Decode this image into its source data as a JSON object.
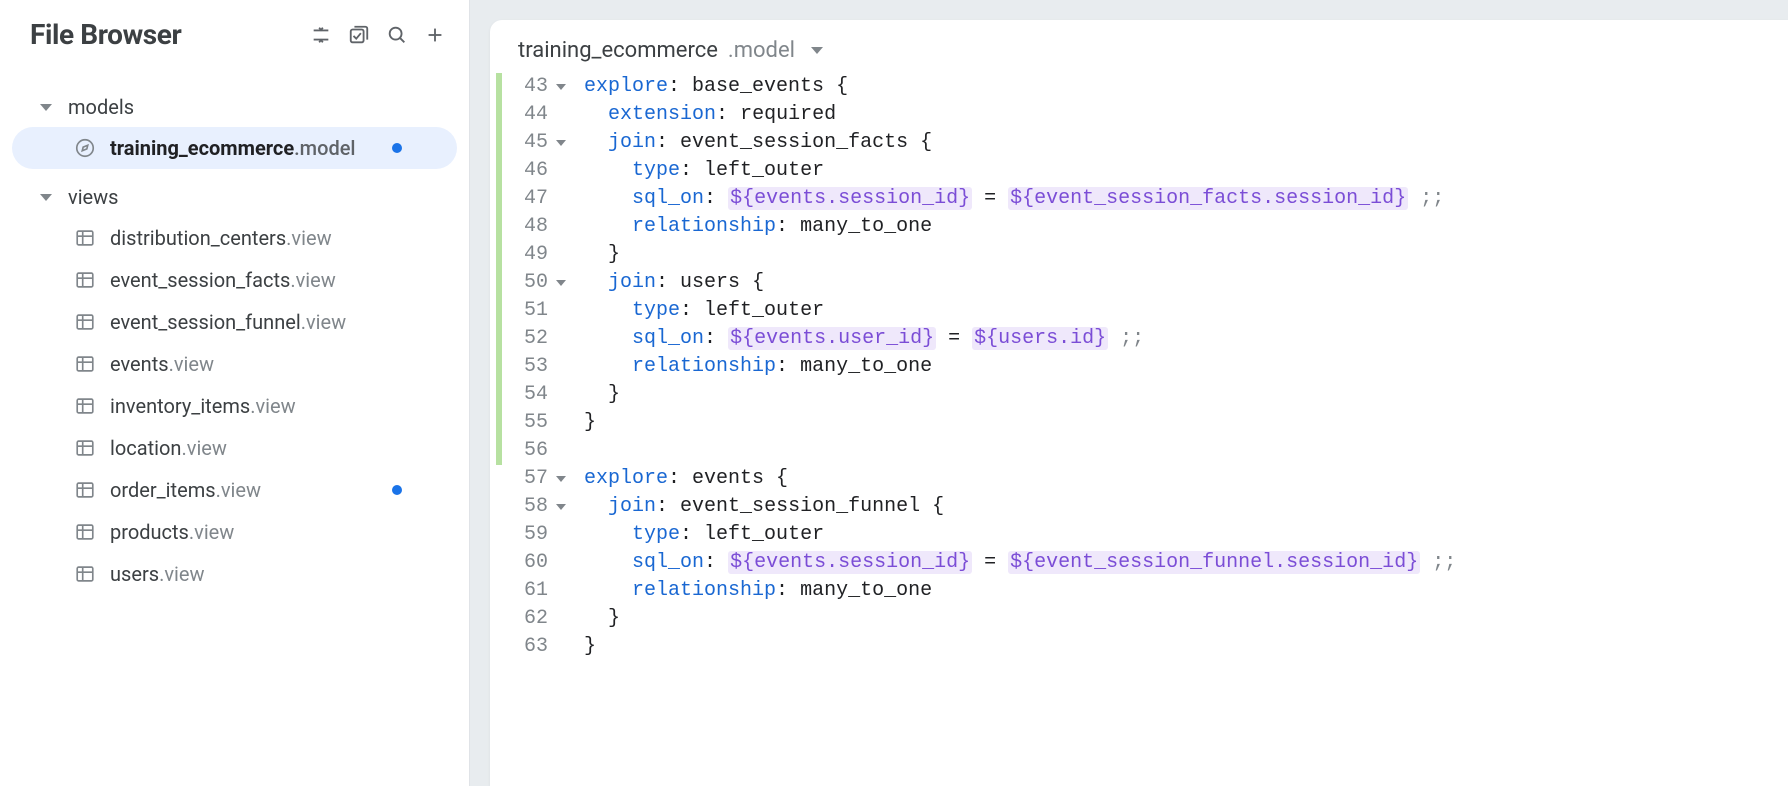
{
  "sidebar": {
    "title": "File Browser",
    "folders": [
      {
        "label": "models",
        "files": [
          {
            "name": "training_ecommerce",
            "ext": ".model",
            "icon": "compass",
            "active": true,
            "modified": true
          }
        ]
      },
      {
        "label": "views",
        "files": [
          {
            "name": "distribution_centers",
            "ext": ".view",
            "icon": "table",
            "active": false,
            "modified": false
          },
          {
            "name": "event_session_facts",
            "ext": ".view",
            "icon": "table",
            "active": false,
            "modified": false
          },
          {
            "name": "event_session_funnel",
            "ext": ".view",
            "icon": "table",
            "active": false,
            "modified": false
          },
          {
            "name": "events",
            "ext": ".view",
            "icon": "table",
            "active": false,
            "modified": false
          },
          {
            "name": "inventory_items",
            "ext": ".view",
            "icon": "table",
            "active": false,
            "modified": false
          },
          {
            "name": "location",
            "ext": ".view",
            "icon": "table",
            "active": false,
            "modified": false
          },
          {
            "name": "order_items",
            "ext": ".view",
            "icon": "table",
            "active": false,
            "modified": true
          },
          {
            "name": "products",
            "ext": ".view",
            "icon": "table",
            "active": false,
            "modified": false
          },
          {
            "name": "users",
            "ext": ".view",
            "icon": "table",
            "active": false,
            "modified": false
          }
        ]
      }
    ]
  },
  "editor": {
    "tab": {
      "name": "training_ecommerce",
      "ext": ".model"
    },
    "first_line_number": 43,
    "lines": [
      {
        "n": 43,
        "mod": true,
        "fold": true,
        "indent": 0,
        "tokens": [
          [
            "key",
            "explore"
          ],
          [
            "punc",
            ":"
          ],
          [
            "plain",
            " base_events "
          ],
          [
            "punc",
            "{"
          ]
        ]
      },
      {
        "n": 44,
        "mod": true,
        "fold": false,
        "indent": 1,
        "tokens": [
          [
            "key",
            "extension"
          ],
          [
            "punc",
            ":"
          ],
          [
            "plain",
            " required"
          ]
        ]
      },
      {
        "n": 45,
        "mod": true,
        "fold": true,
        "indent": 1,
        "tokens": [
          [
            "key",
            "join"
          ],
          [
            "punc",
            ":"
          ],
          [
            "plain",
            " event_session_facts "
          ],
          [
            "punc",
            "{"
          ]
        ]
      },
      {
        "n": 46,
        "mod": true,
        "fold": false,
        "indent": 2,
        "tokens": [
          [
            "key",
            "type"
          ],
          [
            "punc",
            ":"
          ],
          [
            "plain",
            " left_outer"
          ]
        ]
      },
      {
        "n": 47,
        "mod": true,
        "fold": false,
        "indent": 2,
        "tokens": [
          [
            "key",
            "sql_on"
          ],
          [
            "punc",
            ":"
          ],
          [
            "plain",
            " "
          ],
          [
            "int",
            "${events.session_id}"
          ],
          [
            "plain",
            " = "
          ],
          [
            "int",
            "${event_session_facts.session_id}"
          ],
          [
            "plain",
            " "
          ],
          [
            "semi",
            ";;"
          ]
        ]
      },
      {
        "n": 48,
        "mod": true,
        "fold": false,
        "indent": 2,
        "tokens": [
          [
            "key",
            "relationship"
          ],
          [
            "punc",
            ":"
          ],
          [
            "plain",
            " many_to_one"
          ]
        ]
      },
      {
        "n": 49,
        "mod": true,
        "fold": false,
        "indent": 1,
        "tokens": [
          [
            "punc",
            "}"
          ]
        ]
      },
      {
        "n": 50,
        "mod": true,
        "fold": true,
        "indent": 1,
        "tokens": [
          [
            "key",
            "join"
          ],
          [
            "punc",
            ":"
          ],
          [
            "plain",
            " users "
          ],
          [
            "punc",
            "{"
          ]
        ]
      },
      {
        "n": 51,
        "mod": true,
        "fold": false,
        "indent": 2,
        "tokens": [
          [
            "key",
            "type"
          ],
          [
            "punc",
            ":"
          ],
          [
            "plain",
            " left_outer"
          ]
        ]
      },
      {
        "n": 52,
        "mod": true,
        "fold": false,
        "indent": 2,
        "tokens": [
          [
            "key",
            "sql_on"
          ],
          [
            "punc",
            ":"
          ],
          [
            "plain",
            " "
          ],
          [
            "int",
            "${events.user_id}"
          ],
          [
            "plain",
            " = "
          ],
          [
            "int",
            "${users.id}"
          ],
          [
            "plain",
            " "
          ],
          [
            "semi",
            ";;"
          ]
        ]
      },
      {
        "n": 53,
        "mod": true,
        "fold": false,
        "indent": 2,
        "tokens": [
          [
            "key",
            "relationship"
          ],
          [
            "punc",
            ":"
          ],
          [
            "plain",
            " many_to_one"
          ]
        ]
      },
      {
        "n": 54,
        "mod": true,
        "fold": false,
        "indent": 1,
        "tokens": [
          [
            "punc",
            "}"
          ]
        ]
      },
      {
        "n": 55,
        "mod": true,
        "fold": false,
        "indent": 0,
        "tokens": [
          [
            "punc",
            "}"
          ]
        ]
      },
      {
        "n": 56,
        "mod": true,
        "fold": false,
        "indent": 0,
        "tokens": []
      },
      {
        "n": 57,
        "mod": false,
        "fold": true,
        "indent": 0,
        "tokens": [
          [
            "key",
            "explore"
          ],
          [
            "punc",
            ":"
          ],
          [
            "plain",
            " events "
          ],
          [
            "punc",
            "{"
          ]
        ]
      },
      {
        "n": 58,
        "mod": false,
        "fold": true,
        "indent": 1,
        "tokens": [
          [
            "key",
            "join"
          ],
          [
            "punc",
            ":"
          ],
          [
            "plain",
            " event_session_funnel "
          ],
          [
            "punc",
            "{"
          ]
        ]
      },
      {
        "n": 59,
        "mod": false,
        "fold": false,
        "indent": 2,
        "tokens": [
          [
            "key",
            "type"
          ],
          [
            "punc",
            ":"
          ],
          [
            "plain",
            " left_outer"
          ]
        ]
      },
      {
        "n": 60,
        "mod": false,
        "fold": false,
        "indent": 2,
        "tokens": [
          [
            "key",
            "sql_on"
          ],
          [
            "punc",
            ":"
          ],
          [
            "plain",
            " "
          ],
          [
            "int",
            "${events.session_id}"
          ],
          [
            "plain",
            " = "
          ],
          [
            "int",
            "${event_session_funnel.session_id}"
          ],
          [
            "plain",
            " "
          ],
          [
            "semi",
            ";;"
          ]
        ]
      },
      {
        "n": 61,
        "mod": false,
        "fold": false,
        "indent": 2,
        "tokens": [
          [
            "key",
            "relationship"
          ],
          [
            "punc",
            ":"
          ],
          [
            "plain",
            " many_to_one"
          ]
        ]
      },
      {
        "n": 62,
        "mod": false,
        "fold": false,
        "indent": 1,
        "tokens": [
          [
            "punc",
            "}"
          ]
        ]
      },
      {
        "n": 63,
        "mod": false,
        "fold": false,
        "indent": 0,
        "tokens": [
          [
            "punc",
            "}"
          ]
        ]
      }
    ]
  }
}
